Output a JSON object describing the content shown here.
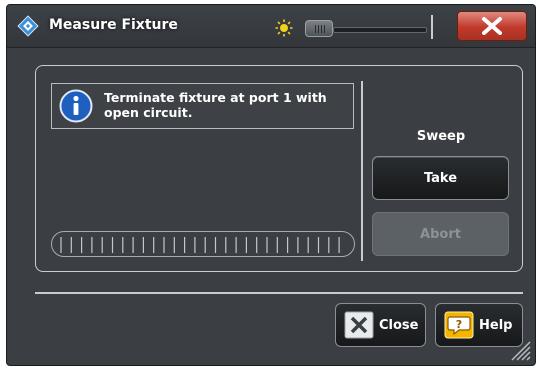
{
  "window": {
    "title": "Measure Fixture",
    "close_icon": "close-x-icon",
    "app_icon": "rohde-schwarz-diamond-icon",
    "brightness_icon": "sun-icon"
  },
  "message": {
    "icon": "info-icon",
    "text": "Terminate fixture at port 1 with open circuit."
  },
  "progress": {
    "value": 0
  },
  "sweep": {
    "label": "Sweep",
    "take_label": "Take",
    "abort_label": "Abort"
  },
  "footer": {
    "close_label": "Close",
    "help_label": "Help"
  },
  "colors": {
    "window_bg": "#3b3f43",
    "title_close_red": "#c0392b",
    "info_blue": "#1e5fbf",
    "help_yellow": "#f5b400"
  }
}
